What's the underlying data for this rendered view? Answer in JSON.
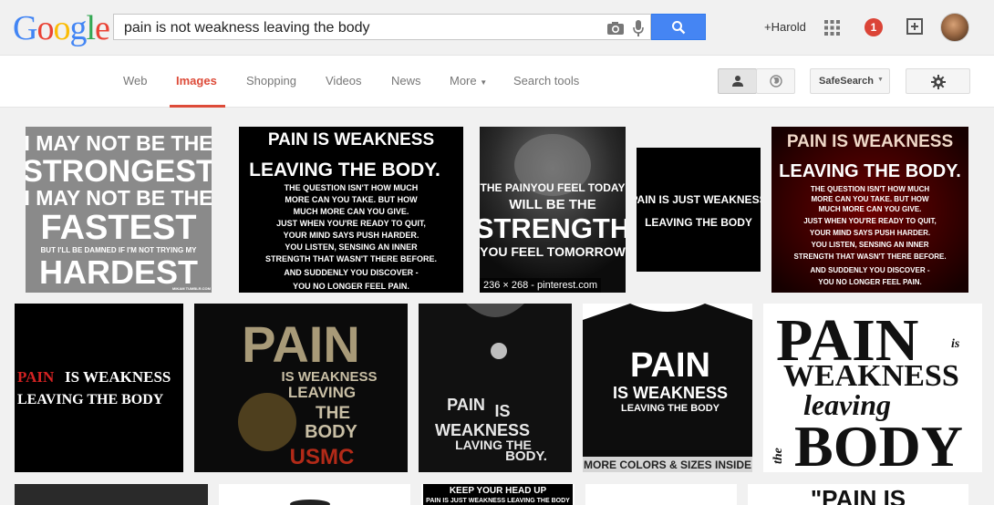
{
  "logo_letters": [
    {
      "ch": "G",
      "color": "#4285f4"
    },
    {
      "ch": "o",
      "color": "#ea4335"
    },
    {
      "ch": "o",
      "color": "#fbbc05"
    },
    {
      "ch": "g",
      "color": "#4285f4"
    },
    {
      "ch": "l",
      "color": "#34a853"
    },
    {
      "ch": "e",
      "color": "#ea4335"
    }
  ],
  "search": {
    "query": "pain is not weakness leaving the body"
  },
  "header": {
    "user": "+Harold",
    "notification_count": "1"
  },
  "tabs": [
    "Web",
    "Images",
    "Shopping",
    "Videos",
    "News",
    "More",
    "Search tools"
  ],
  "active_tab": "Images",
  "toolbar": {
    "safesearch_label": "SafeSearch"
  },
  "colors": {
    "accent": "#dd4b39",
    "search_button": "#4585f3"
  },
  "images": [
    {
      "lines": [
        "I MAY NOT BE THE",
        "STRONGEST",
        "I MAY NOT BE THE",
        "FASTEST",
        "BUT I'LL BE DAMNED IF I'M NOT TRYING MY",
        "HARDEST",
        "MIKAM TUMBLR.COM"
      ]
    },
    {
      "lines": [
        "PAIN IS WEAKNESS",
        "LEAVING THE BODY.",
        "THE QUESTION ISN'T HOW MUCH",
        "MORE CAN YOU TAKE. BUT HOW",
        "MUCH MORE CAN YOU GIVE.",
        "JUST WHEN YOU'RE READY TO QUIT,",
        "YOUR MIND SAYS PUSH HARDER.",
        "YOU LISTEN, SENSING AN INNER",
        "STRENGTH THAT WASN'T THERE BEFORE.",
        "AND SUDDENLY YOU DISCOVER -",
        "YOU NO LONGER FEEL PAIN."
      ]
    },
    {
      "lines": [
        "THE PAINYOU FEEL TODAY",
        "WILL BE THE",
        "STRENGTH",
        "YOU FEEL TOMORROW"
      ],
      "caption": "236 × 268 - pinterest.com"
    },
    {
      "lines": [
        "PAIN IS JUST WEAKNESS",
        "LEAVING THE BODY"
      ]
    },
    {
      "lines": [
        "PAIN IS WEAKNESS",
        "LEAVING THE BODY.",
        "THE QUESTION ISN'T HOW MUCH",
        "MORE CAN YOU TAKE. BUT HOW",
        "MUCH MORE CAN YOU GIVE.",
        "JUST WHEN YOU'RE READY TO QUIT,",
        "YOUR MIND SAYS PUSH HARDER.",
        "YOU LISTEN, SENSING AN INNER",
        "STRENGTH THAT WASN'T THERE BEFORE.",
        "AND SUDDENLY YOU DISCOVER -",
        "YOU NO LONGER FEEL PAIN."
      ]
    },
    {
      "lines": [
        "PAIN",
        "IS WEAKNESS",
        "LEAVING THE BODY"
      ]
    },
    {
      "lines": [
        "PAIN",
        "IS WEAKNESS",
        "LEAVING",
        "THE",
        "BODY",
        "USMC"
      ]
    },
    {
      "lines": [
        "PAIN",
        "IS",
        "WEAKNESS",
        "LAVING THE",
        "BODY."
      ]
    },
    {
      "lines": [
        "PAIN",
        "IS WEAKNESS",
        "LEAVING THE BODY",
        "MORE COLORS & SIZES INSIDE"
      ]
    },
    {
      "lines": [
        "PAIN",
        "is",
        "WEAKNESS",
        "leaving",
        "the",
        "BODY"
      ]
    },
    {
      "lines": [
        "KEEP YOUR HEAD UP",
        "PAIN IS JUST WEAKNESS LEAVING THE BODY"
      ]
    },
    {
      "lines": [
        "\"PAIN IS"
      ]
    }
  ]
}
